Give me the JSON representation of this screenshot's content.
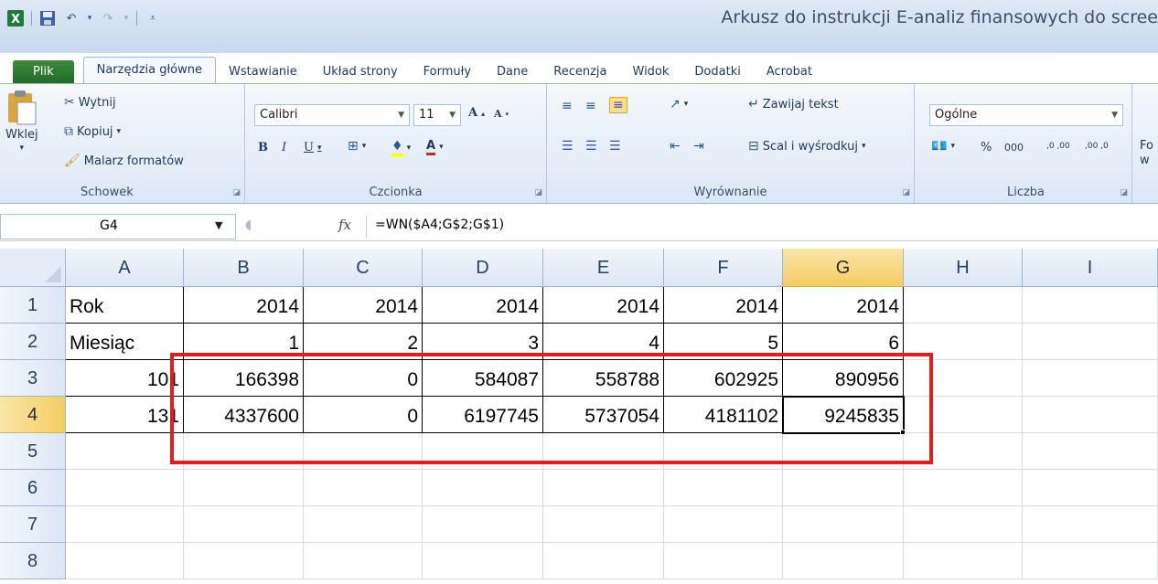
{
  "window": {
    "title": "Arkusz do instrukcji E-analiz finansowych do scree"
  },
  "qat": {
    "icons": [
      "excel-logo-icon",
      "save-icon",
      "undo-icon",
      "redo-icon",
      "customize-icon"
    ]
  },
  "tabs": [
    {
      "label": "Plik",
      "name": "tab-file"
    },
    {
      "label": "Narzędzia główne",
      "name": "tab-home"
    },
    {
      "label": "Wstawianie",
      "name": "tab-insert"
    },
    {
      "label": "Układ strony",
      "name": "tab-page-layout"
    },
    {
      "label": "Formuły",
      "name": "tab-formulas"
    },
    {
      "label": "Dane",
      "name": "tab-data"
    },
    {
      "label": "Recenzja",
      "name": "tab-review"
    },
    {
      "label": "Widok",
      "name": "tab-view"
    },
    {
      "label": "Dodatki",
      "name": "tab-addins"
    },
    {
      "label": "Acrobat",
      "name": "tab-acrobat"
    }
  ],
  "ribbon": {
    "clipboard": {
      "group_label": "Schowek",
      "paste": "Wklej",
      "cut": "Wytnij",
      "copy": "Kopiuj",
      "format_painter": "Malarz formatów"
    },
    "font": {
      "group_label": "Czcionka",
      "font_name": "Calibri",
      "font_size": "11",
      "bold": "B",
      "italic": "I",
      "underline": "U",
      "font_color_letter": "A"
    },
    "alignment": {
      "group_label": "Wyrównanie",
      "wrap_text": "Zawijaj tekst",
      "merge_center": "Scal i wyśrodkuj"
    },
    "number": {
      "group_label": "Liczba",
      "format": "Ogólne",
      "percent": "%",
      "thousands": "000",
      "inc_decimal": ",0 ,00",
      "dec_decimal": ",00 ,0"
    },
    "styles_partial": "Fo\nw"
  },
  "formula_bar": {
    "name_box": "G4",
    "fx": "fx",
    "formula": "=WN($A4;G$2;G$1)"
  },
  "sheet": {
    "columns": [
      "A",
      "B",
      "C",
      "D",
      "E",
      "F",
      "G",
      "H",
      "I"
    ],
    "selected_column": "G",
    "selected_row": "4",
    "rows": [
      {
        "num": "1",
        "cells": [
          "Rok",
          "2014",
          "2014",
          "2014",
          "2014",
          "2014",
          "2014",
          "",
          ""
        ]
      },
      {
        "num": "2",
        "cells": [
          "Miesiąc",
          "1",
          "2",
          "3",
          "4",
          "5",
          "6",
          "",
          ""
        ]
      },
      {
        "num": "3",
        "cells": [
          "101",
          "166398",
          "0",
          "584087",
          "558788",
          "602925",
          "890956",
          "",
          ""
        ]
      },
      {
        "num": "4",
        "cells": [
          "131",
          "4337600",
          "0",
          "6197745",
          "5737054",
          "4181102",
          "9245835",
          "",
          ""
        ]
      },
      {
        "num": "5",
        "cells": [
          "",
          "",
          "",
          "",
          "",
          "",
          "",
          "",
          ""
        ]
      },
      {
        "num": "6",
        "cells": [
          "",
          "",
          "",
          "",
          "",
          "",
          "",
          "",
          ""
        ]
      },
      {
        "num": "7",
        "cells": [
          "",
          "",
          "",
          "",
          "",
          "",
          "",
          "",
          ""
        ]
      },
      {
        "num": "8",
        "cells": [
          "",
          "",
          "",
          "",
          "",
          "",
          "",
          "",
          ""
        ]
      }
    ],
    "highlight_color": "#e51c1c",
    "selection_header_color": "#f4cc63"
  }
}
